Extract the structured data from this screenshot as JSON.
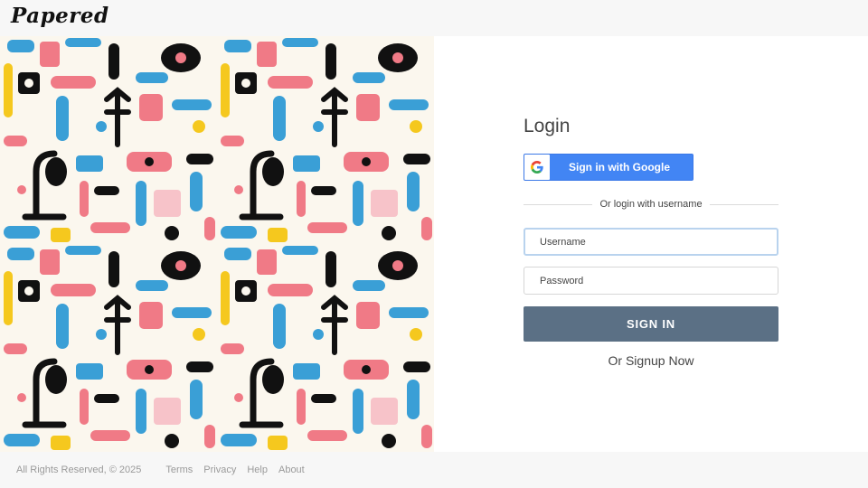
{
  "header": {
    "logo_text": "Papered"
  },
  "art": {
    "colors": {
      "cream": "#fbf7ee",
      "blue": "#3a9fd6",
      "pink": "#f07a86",
      "yellow": "#f5c81e",
      "black": "#111111",
      "light_pink": "#f7c3c9"
    }
  },
  "login": {
    "title": "Login",
    "google_button_label": "Sign in with Google",
    "divider_text": "Or login with username",
    "username_placeholder": "Username",
    "password_placeholder": "Password",
    "signin_label": "SIGN IN",
    "signup_label": "Or Signup Now"
  },
  "footer": {
    "copyright": "All Rights Reserved, © 2025",
    "links": [
      "Terms",
      "Privacy",
      "Help",
      "About"
    ]
  },
  "colors": {
    "google_blue": "#4285f4",
    "signin_button": "#5b7085",
    "focus_border": "#b9d3ee"
  }
}
